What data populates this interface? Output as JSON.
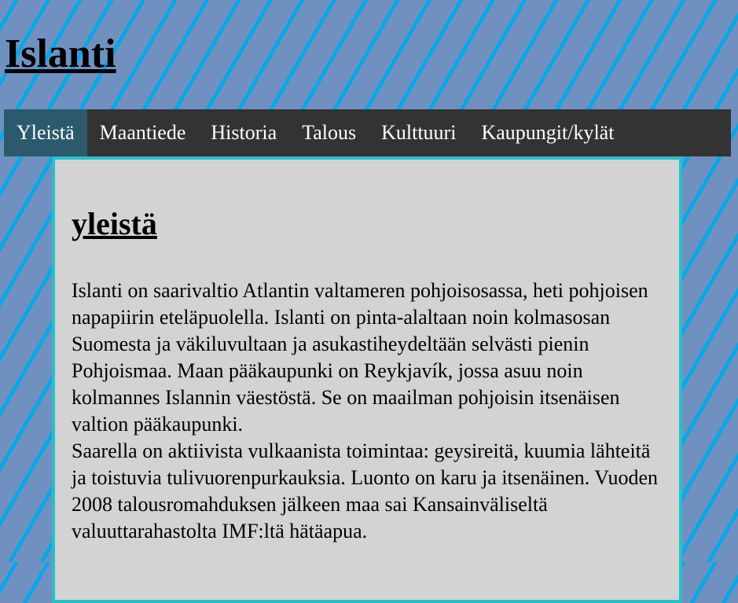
{
  "site": {
    "title": "Islanti"
  },
  "nav": {
    "items": [
      {
        "label": "Yleistä",
        "active": true
      },
      {
        "label": "Maantiede",
        "active": false
      },
      {
        "label": "Historia",
        "active": false
      },
      {
        "label": "Talous",
        "active": false
      },
      {
        "label": "Kulttuuri",
        "active": false
      },
      {
        "label": "Kaupungit/kylät",
        "active": false
      }
    ]
  },
  "main": {
    "heading": "yleistä",
    "paragraphs": [
      "Islanti on saarivaltio Atlantin valtameren pohjoisosassa, heti pohjoisen napapiirin eteläpuolella. Islanti on pinta-alaltaan noin kolmasosan Suomesta ja väkiluvultaan ja asukastiheydeltään selvästi pienin Pohjoismaa. Maan pääkaupunki on Reykjavík, jossa asuu noin kolmannes Islannin väestöstä. Se on maailman pohjoisin itsenäisen valtion pääkaupunki.",
      "Saarella on aktiivista vulkaanista toimintaa: geysireitä, kuumia lähteitä ja toistuvia tulivuorenpurkauksia. Luonto on karu ja itsenäinen. Vuoden 2008 talousromahduksen jälkeen maa sai Kansainväliseltä valuuttarahastolta IMF:ltä hätäapua."
    ]
  },
  "colors": {
    "background": "#7091c0",
    "stripes": "#08a8e8",
    "nav_bg": "#333333",
    "nav_active": "#2c5a6c",
    "content_bg": "#d3d3d3",
    "content_border": "#26c1c9"
  }
}
